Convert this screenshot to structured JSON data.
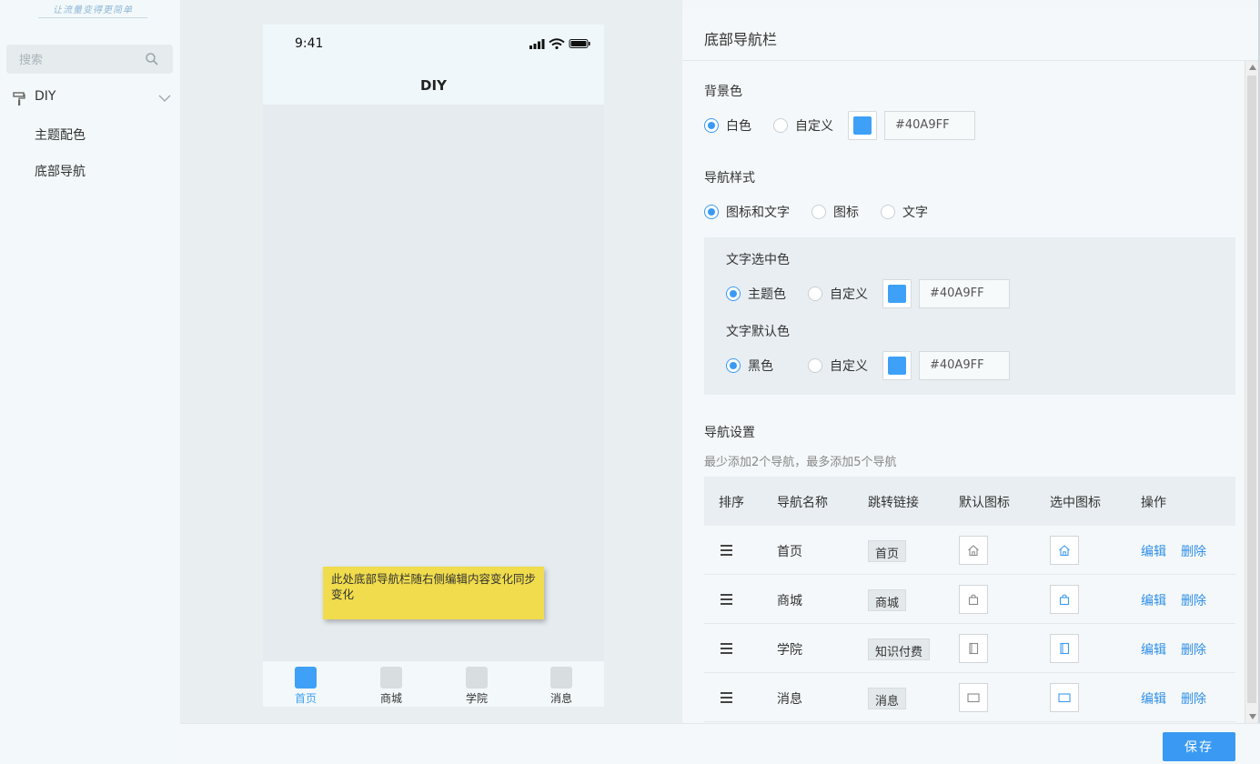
{
  "sidebar": {
    "logo_text": "让流量变得更简单",
    "search_placeholder": "搜索",
    "group_label": "DIY",
    "items": [
      {
        "label": "主题配色"
      },
      {
        "label": "底部导航"
      }
    ]
  },
  "phone": {
    "time": "9:41",
    "title": "DIY",
    "note": "此处底部导航栏随右侧编辑内容变化同步变化",
    "tabs": [
      {
        "label": "首页",
        "active": true
      },
      {
        "label": "商城",
        "active": false
      },
      {
        "label": "学院",
        "active": false
      },
      {
        "label": "消息",
        "active": false
      }
    ]
  },
  "panel": {
    "title": "底部导航栏",
    "background": {
      "label": "背景色",
      "option_white": "白色",
      "option_custom": "自定义",
      "hex": "#40A9FF"
    },
    "nav_style": {
      "label": "导航样式",
      "option_icon_text": "图标和文字",
      "option_icon": "图标",
      "option_text": "文字"
    },
    "text_selected": {
      "label": "文字选中色",
      "option_theme": "主题色",
      "option_custom": "自定义",
      "hex": "#40A9FF"
    },
    "text_default": {
      "label": "文字默认色",
      "option_black": "黑色",
      "option_custom": "自定义",
      "hex": "#40A9FF"
    },
    "nav_settings": {
      "label": "导航设置",
      "hint": "最少添加2个导航，最多添加5个导航",
      "headers": [
        "排序",
        "导航名称",
        "跳转链接",
        "默认图标",
        "选中图标",
        "操作"
      ],
      "edit_label": "编辑",
      "delete_label": "删除",
      "rows": [
        {
          "name": "首页",
          "link": "首页",
          "icon": "home-icon"
        },
        {
          "name": "商城",
          "link": "商城",
          "icon": "bag-icon"
        },
        {
          "name": "学院",
          "link": "知识付费",
          "icon": "book-icon"
        },
        {
          "name": "消息",
          "link": "消息",
          "icon": "message-icon"
        }
      ]
    }
  },
  "footer": {
    "save_label": "保存"
  },
  "colors": {
    "accent": "#3A9AF3",
    "swatch": "#40A9FF",
    "note_bg": "#F0DC4C"
  }
}
